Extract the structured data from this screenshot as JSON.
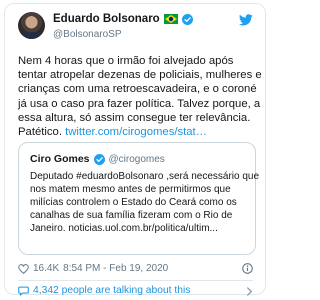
{
  "tweet": {
    "author": {
      "name": "Eduardo Bolsonaro",
      "handle": "@BolsonaroSP",
      "flag": "Brazil",
      "verified": true
    },
    "text_lines": [
      "Nem 4 horas que o irmão foi alvejado após",
      "tentar atropelar dezenas de policiais, mulheres e",
      "crianças com uma retroescavadeira, e o coroné",
      "já usa o caso pra fazer política. Talvez porque, a",
      "essa altura, só assim consegue ter relevância.",
      "Patético."
    ],
    "link": "twitter.com/cirogomes/stat…",
    "quoted": {
      "name": "Ciro Gomes",
      "handle": "@cirogomes",
      "verified": true,
      "text_lines": [
        "Deputado #eduardoBolsonaro ,será  necessário que",
        "nos matem mesmo antes de permitirmos que",
        "milícias controlem o Estado do Ceará como os",
        "canalhas de sua família fizeram com o Rio de",
        "Janeiro. noticias.uol.com.br/politica/ultim..."
      ]
    },
    "likes": "16.4K",
    "timestamp": "8:54 PM - Feb 19, 2020",
    "talking": "4,342 people are talking about this"
  },
  "colors": {
    "link_blue": "#1b95e0",
    "twitter_blue": "#1da1f2",
    "secondary_text": "#657786",
    "border": "#e1e8ed"
  },
  "icons": [
    "twitter-bird-icon",
    "verified-badge-icon",
    "brazil-flag-icon",
    "heart-icon",
    "info-icon",
    "comment-bubble-icon",
    "chevron-right-icon"
  ]
}
